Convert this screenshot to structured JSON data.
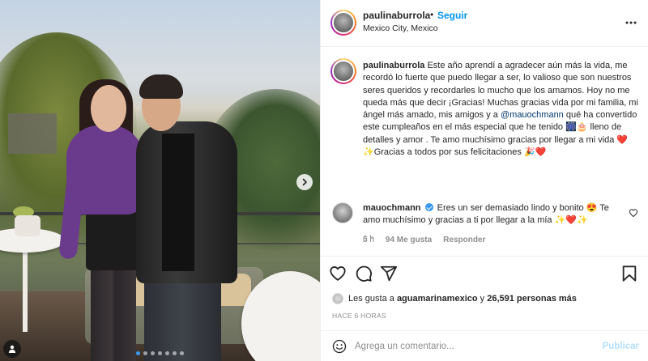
{
  "post": {
    "username": "paulinaburrola",
    "separator": "•",
    "follow_label": "Seguir",
    "location": "Mexico City, Mexico",
    "more_icon": "more-horizontal-icon"
  },
  "caption": {
    "username": "paulinaburrola",
    "text_1": "Este año aprendí a agradecer aún más la vida, me recordó lo fuerte que puedo llegar a ser, lo valioso que son nuestros seres queridos y recordarles lo mucho que los amamos. Hoy no me queda más que decir ¡Gracias! Muchas gracias vida por mi familia, mi ángel más amado, mis amigos y a",
    "mention": "@mauochmann",
    "text_2": "qué ha convertido este cumpleaños en el más especial que he tenido 🎆🎂 lleno de detalles y amor . Te amo muchísimo gracias por llegar a mi vida ❤️",
    "text_3": "✨Gracias a todos por sus felicitaciones 🎉❤️",
    "time": "6 h"
  },
  "comment": {
    "username": "mauochmann",
    "text": "Eres un ser demasiado lindo y bonito 😍 Te amo muchísimo y gracias a ti por llegar a la mía ✨❤️✨",
    "time": "5 h",
    "likes": "94 Me gusta",
    "reply": "Responder"
  },
  "stats": {
    "likes_prefix": "Les gusta a",
    "liker": "aguamarinamexico",
    "likes_conj": "y",
    "likes_count": "26,591 personas más",
    "post_time": "HACE 6 HORAS"
  },
  "add_comment": {
    "placeholder": "Agrega un comentario...",
    "publish": "Publicar"
  },
  "carousel": {
    "current": 1,
    "total": 7
  },
  "colors": {
    "link": "#0095f6",
    "mention": "#00376b",
    "heart": "#ed4956",
    "muted": "#8e8e8e"
  }
}
